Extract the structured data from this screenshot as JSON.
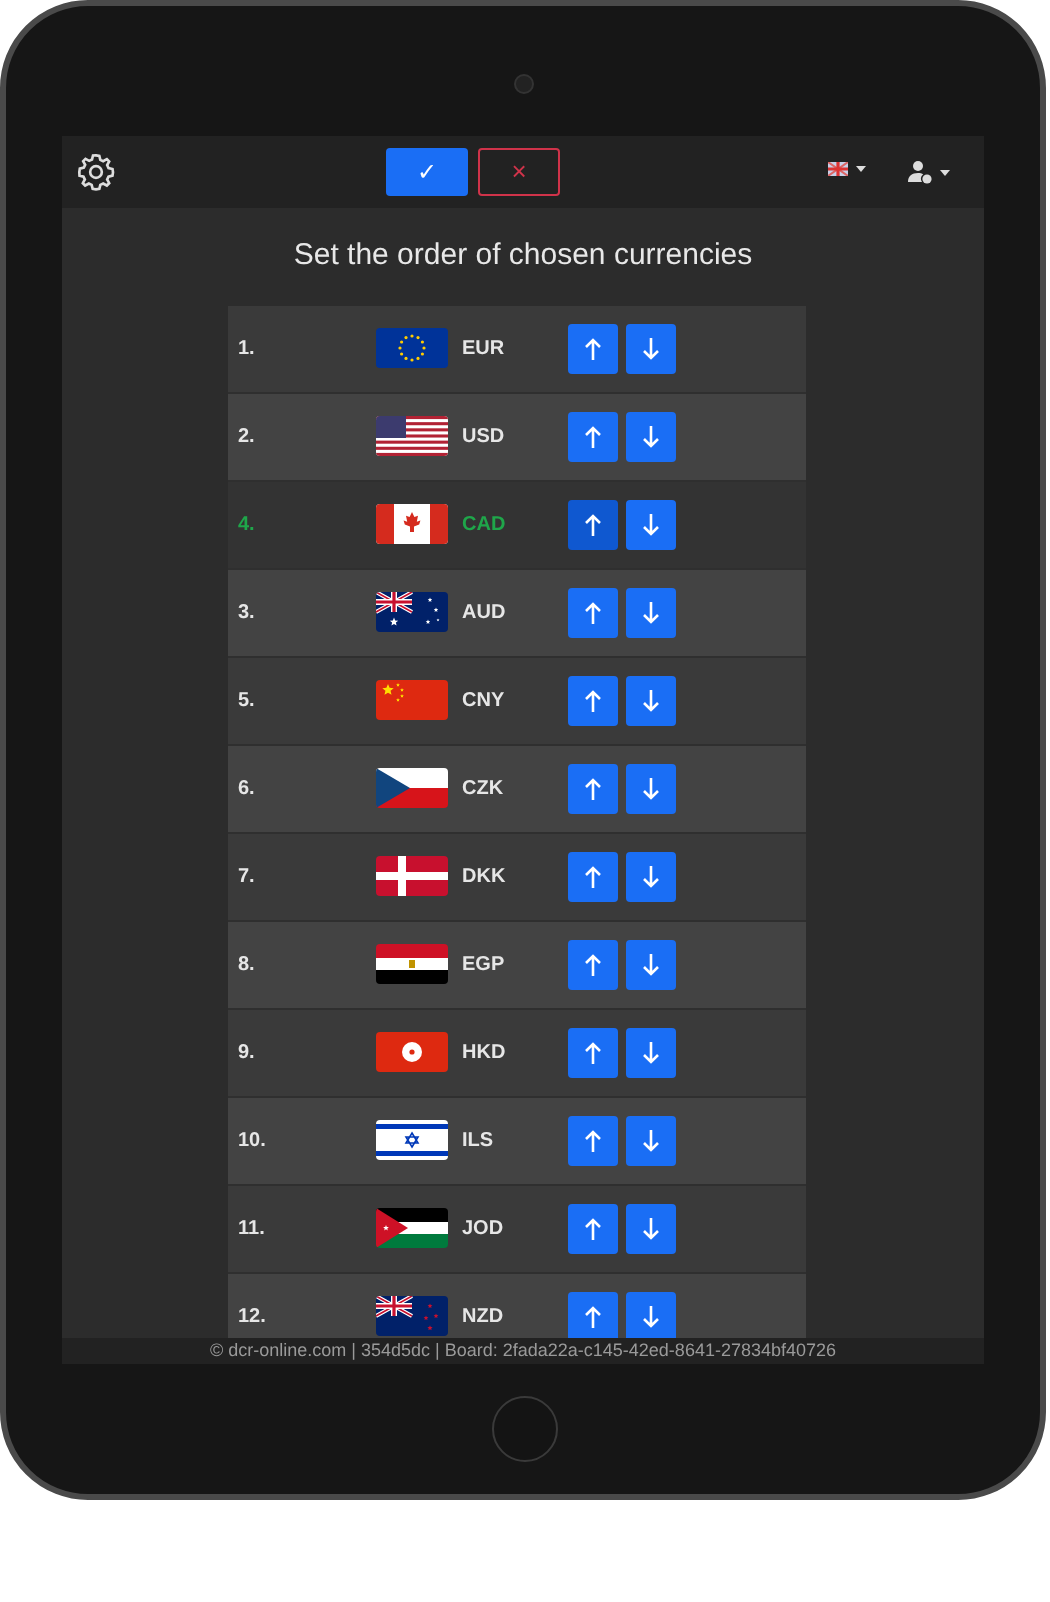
{
  "header": {
    "confirm_button": "✓",
    "cancel_button": "×"
  },
  "title": "Set the order of chosen currencies",
  "rows": [
    {
      "number": "1.",
      "code": "EUR",
      "highlighted": false
    },
    {
      "number": "2.",
      "code": "USD",
      "highlighted": false
    },
    {
      "number": "4.",
      "code": "CAD",
      "highlighted": true
    },
    {
      "number": "3.",
      "code": "AUD",
      "highlighted": false
    },
    {
      "number": "5.",
      "code": "CNY",
      "highlighted": false
    },
    {
      "number": "6.",
      "code": "CZK",
      "highlighted": false
    },
    {
      "number": "7.",
      "code": "DKK",
      "highlighted": false
    },
    {
      "number": "8.",
      "code": "EGP",
      "highlighted": false
    },
    {
      "number": "9.",
      "code": "HKD",
      "highlighted": false
    },
    {
      "number": "10.",
      "code": "ILS",
      "highlighted": false
    },
    {
      "number": "11.",
      "code": "JOD",
      "highlighted": false
    },
    {
      "number": "12.",
      "code": "NZD",
      "highlighted": false
    }
  ],
  "footer": "© dcr-online.com | 354d5dc | Board: 2fada22a-c145-42ed-8641-27834bf40726"
}
